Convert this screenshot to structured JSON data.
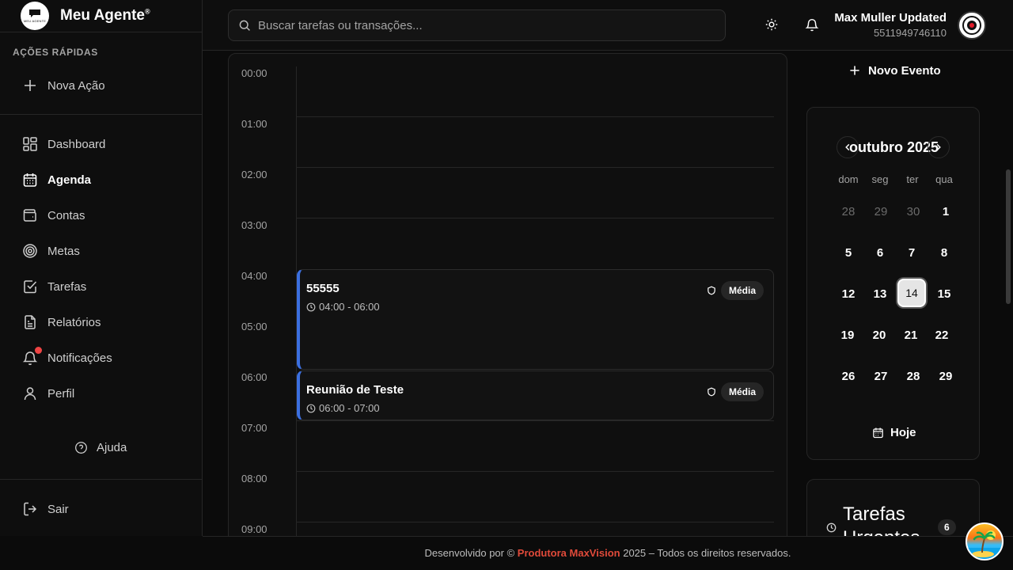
{
  "brand": {
    "name": "Meu Agente",
    "mark": "®",
    "logo_text": "MEU AGENTE"
  },
  "sidebar": {
    "section_title": "AÇÕES RÁPIDAS",
    "new_action": "Nova Ação",
    "items": [
      {
        "label": "Dashboard",
        "icon": "dashboard-icon"
      },
      {
        "label": "Agenda",
        "icon": "calendar-icon",
        "active": true
      },
      {
        "label": "Contas",
        "icon": "wallet-icon"
      },
      {
        "label": "Metas",
        "icon": "target-icon"
      },
      {
        "label": "Tarefas",
        "icon": "checkbox-icon"
      },
      {
        "label": "Relatórios",
        "icon": "document-icon"
      },
      {
        "label": "Notificações",
        "icon": "bell-icon"
      },
      {
        "label": "Perfil",
        "icon": "user-icon"
      }
    ],
    "help": "Ajuda",
    "logout": "Sair"
  },
  "header": {
    "search_placeholder": "Buscar tarefas ou transações...",
    "user_name": "Max Muller Updated",
    "user_phone": "5511949746110"
  },
  "timeline": {
    "hours": [
      "00:00",
      "01:00",
      "02:00",
      "03:00",
      "04:00",
      "05:00",
      "06:00",
      "07:00",
      "08:00",
      "09:00"
    ],
    "events": [
      {
        "title": "55555",
        "time": "04:00 - 06:00",
        "priority": "Média"
      },
      {
        "title": "Reunião de Teste",
        "time": "06:00 - 07:00",
        "priority": "Média"
      }
    ]
  },
  "right": {
    "new_event": "Novo Evento",
    "calendar": {
      "month": "outubro 2025",
      "weekdays": [
        "dom",
        "seg",
        "ter",
        "qua"
      ],
      "weeks": [
        [
          "28",
          "29",
          "30",
          "1"
        ],
        [
          "5",
          "6",
          "7",
          "8"
        ],
        [
          "12",
          "13",
          "14",
          "15"
        ],
        [
          "19",
          "20",
          "21",
          "22"
        ],
        [
          "26",
          "27",
          "28",
          "29"
        ]
      ],
      "today": "14",
      "today_label": "Hoje"
    },
    "tasks": {
      "title": "Tarefas Urgentes",
      "count": "6"
    }
  },
  "footer": {
    "prefix": "Desenvolvido por ©",
    "company": "Produtora MaxVision",
    "suffix": "2025 – Todos os direitos reservados."
  }
}
